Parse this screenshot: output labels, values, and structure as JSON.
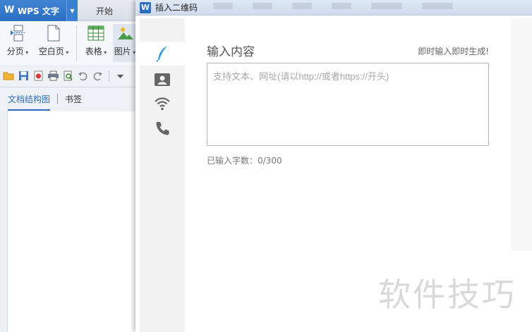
{
  "wps": {
    "app_name": "WPS 文字",
    "menu_tab": "开始",
    "ribbon": {
      "page_break": "分页",
      "blank_page": "空白页",
      "table": "表格",
      "picture": "图片"
    },
    "nav_tabs": {
      "doc_structure": "文档结构图",
      "bookmark": "书签"
    }
  },
  "dialog": {
    "title": "插入二维码",
    "input_heading": "输入内容",
    "input_hint": "即时输入即时生成!",
    "textarea_placeholder": "支持文本、网址(请以http://或者https://开头)",
    "textarea_value": "",
    "char_count": "已输入字数：0/300"
  },
  "watermark": "软件技巧",
  "colors": {
    "wps_blue": "#2a6fc1",
    "accent_feather": "#2b9fd8",
    "side_icon": "#666666"
  }
}
